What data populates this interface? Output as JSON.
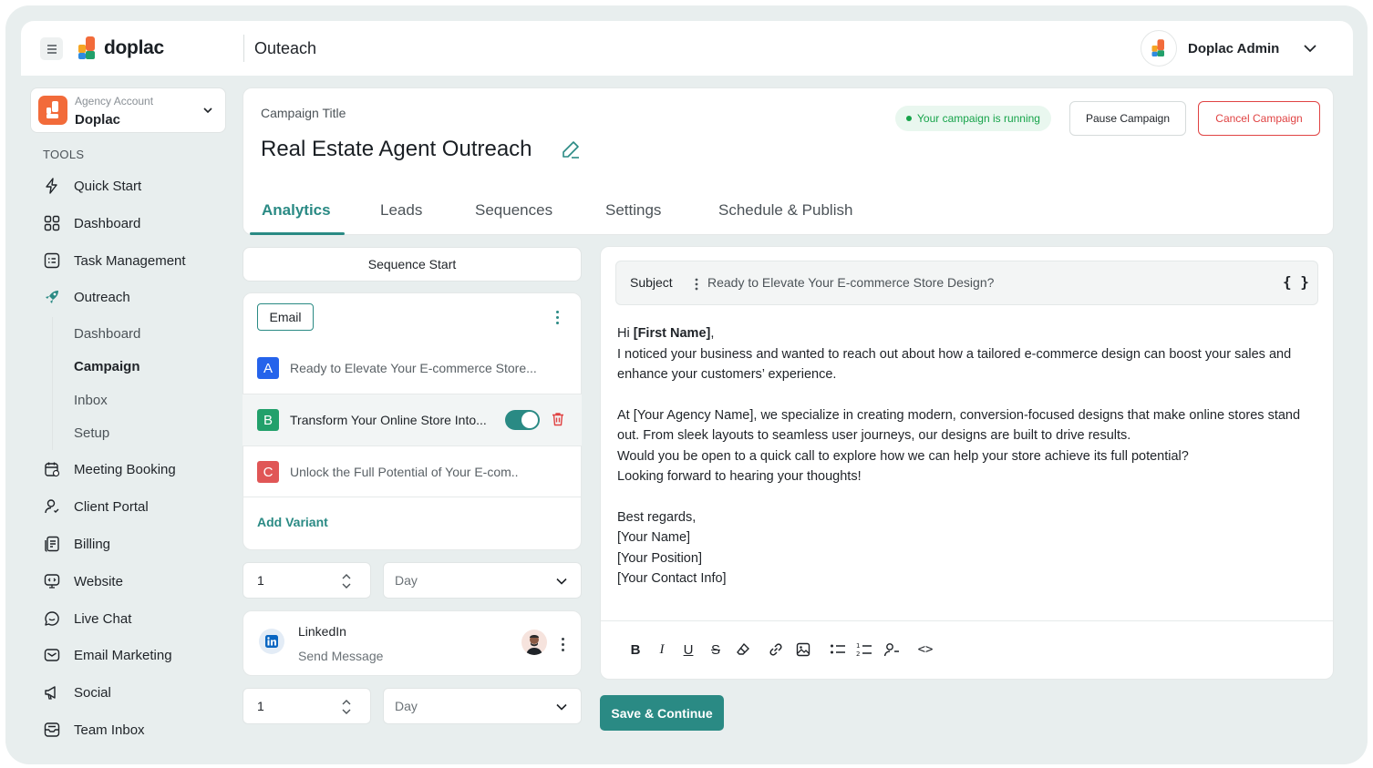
{
  "header": {
    "logo_text": "doplac",
    "page_title": "Outeach",
    "user_name": "Doplac Admin"
  },
  "account": {
    "label": "Agency Account",
    "name": "Doplac"
  },
  "sidebar": {
    "section_label": "TOOLS",
    "items": [
      {
        "label": "Quick Start",
        "icon": "bolt-icon"
      },
      {
        "label": "Dashboard",
        "icon": "grid-icon"
      },
      {
        "label": "Task Management",
        "icon": "checklist-icon"
      },
      {
        "label": "Outreach",
        "icon": "rocket-icon"
      },
      {
        "label": "Meeting Booking",
        "icon": "calendar-icon"
      },
      {
        "label": "Client Portal",
        "icon": "user-icon"
      },
      {
        "label": "Billing",
        "icon": "billing-icon"
      },
      {
        "label": "Website",
        "icon": "website-icon"
      },
      {
        "label": "Live Chat",
        "icon": "chat-icon"
      },
      {
        "label": "Email Marketing",
        "icon": "mail-icon"
      },
      {
        "label": "Social",
        "icon": "megaphone-icon"
      },
      {
        "label": "Team Inbox",
        "icon": "inbox-icon"
      }
    ],
    "outreach_sub": [
      "Dashboard",
      "Campaign",
      "Inbox",
      "Setup"
    ],
    "active_sub": "Campaign"
  },
  "campaign": {
    "title_label": "Campaign Title",
    "title": "Real Estate Agent Outreach",
    "status": "Your campaign is running",
    "pause_label": "Pause Campaign",
    "cancel_label": "Cancel Campaign",
    "tabs": [
      "Analytics",
      "Leads",
      "Sequences",
      "Settings",
      "Schedule & Publish"
    ],
    "active_tab": "Analytics"
  },
  "sequence": {
    "start_label": "Sequence Start",
    "email_chip": "Email",
    "variants": [
      {
        "letter": "A",
        "text": "Ready to Elevate Your E-commerce Store...",
        "color": "#2563eb"
      },
      {
        "letter": "B",
        "text": "Transform Your Online Store Into...",
        "color": "#22a06b"
      },
      {
        "letter": "C",
        "text": "Unlock the Full Potential of Your E-com..",
        "color": "#e05656"
      }
    ],
    "add_variant": "Add Variant",
    "delay1": {
      "value": "1",
      "unit": "Day"
    },
    "linkedin": {
      "title": "LinkedIn",
      "action": "Send Message"
    },
    "delay2": {
      "value": "1",
      "unit": "Day"
    }
  },
  "editor": {
    "subject_label": "Subject",
    "subject_value": "Ready to Elevate Your E-commerce Store Design?",
    "braces": "{ }",
    "greeting_prefix": "Hi ",
    "greeting_name": "[First Name]",
    "greeting_suffix": ",",
    "p1": "I noticed your business and wanted to reach out about how a tailored e-commerce design can boost your sales and enhance your customers’ experience.",
    "p2": "At [Your Agency Name], we specialize in creating modern, conversion-focused designs that make online stores stand out. From sleek layouts to seamless user journeys, our designs are built to drive results.",
    "p3": "Would you be open to a quick call to explore how we can help your store achieve its full potential?",
    "p4": "Looking forward to hearing your thoughts!",
    "sign1": "Best regards,",
    "sign2": "[Your Name]",
    "sign3": "[Your Position]",
    "sign4": "[Your Contact Info]",
    "toolbar": {
      "bold": "B",
      "italic": "I",
      "underline": "U",
      "strike": "S",
      "code": "<>"
    }
  },
  "actions": {
    "save_label": "Save & Continue"
  },
  "colors": {
    "accent": "#2a8a84",
    "danger": "#e04343",
    "success": "#16a34a"
  }
}
